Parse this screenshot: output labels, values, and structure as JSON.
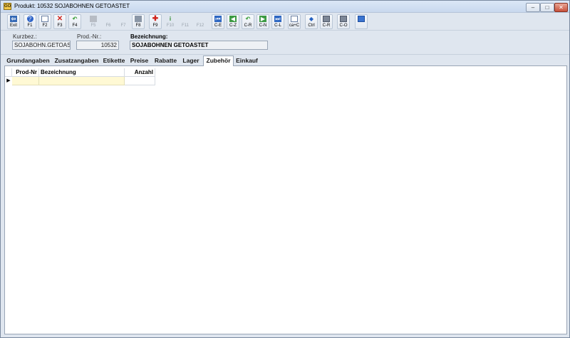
{
  "window": {
    "title": "Produkt: 10532 SOJABOHNEN GETOASTET",
    "app_icon_text": "GO",
    "controls": {
      "minimize": "–",
      "maximize": "□",
      "close": "✕"
    }
  },
  "toolbar": {
    "buttons": [
      {
        "label": "Exit",
        "icon": "exit-icon"
      },
      {
        "label": "F1",
        "icon": "help-icon"
      },
      {
        "label": "F2",
        "icon": "new-document-icon"
      },
      {
        "label": "F3",
        "icon": "delete-icon"
      },
      {
        "label": "F4",
        "icon": "undo-icon"
      },
      {
        "label": "F5",
        "icon": "hand-icon"
      },
      {
        "label": "F6",
        "icon": "disabled-icon"
      },
      {
        "label": "F7",
        "icon": "disabled-icon"
      },
      {
        "label": "F8",
        "icon": "print-icon"
      },
      {
        "label": "F9",
        "icon": "list-icon"
      },
      {
        "label": "F10",
        "icon": "info-icon"
      },
      {
        "label": "F11",
        "icon": "disabled-icon"
      },
      {
        "label": "F12",
        "icon": "disabled-icon"
      },
      {
        "label": "C-E",
        "icon": "first-record-icon"
      },
      {
        "label": "C-Z",
        "icon": "previous-record-icon"
      },
      {
        "label": "C-R",
        "icon": "return-icon"
      },
      {
        "label": "C-N",
        "icon": "next-record-icon"
      },
      {
        "label": "C-L",
        "icon": "last-record-icon"
      },
      {
        "label": "ca+C",
        "icon": "copy-icon"
      },
      {
        "label": "Ctrl",
        "icon": "diamond-icon"
      },
      {
        "label": "C-R",
        "icon": "window-icon"
      },
      {
        "label": "C-O",
        "icon": "window-icon"
      },
      {
        "label": "",
        "icon": "screen-icon"
      }
    ]
  },
  "header": {
    "kurzbez_label": "Kurzbez.:",
    "kurzbez_value": "SOJABOHN.GETOAS",
    "prodnr_label": "Prod.-Nr.:",
    "prodnr_value": "10532",
    "bezeichnung_label": "Bezeichnung:",
    "bezeichnung_value": "SOJABOHNEN GETOASTET"
  },
  "tabs": [
    "Grundangaben",
    "Zusatzangaben",
    "Etikette",
    "Preise",
    "Rabatte",
    "Lager",
    "Zubehör",
    "Einkauf"
  ],
  "active_tab": "Zubehör",
  "grid": {
    "columns": [
      "Prod-Nr",
      "Bezeichnung",
      "Anzahl"
    ],
    "row_indicator": "▶"
  },
  "colors": {
    "selected_row": "#fff9d4",
    "background": "#dfe6ef"
  }
}
